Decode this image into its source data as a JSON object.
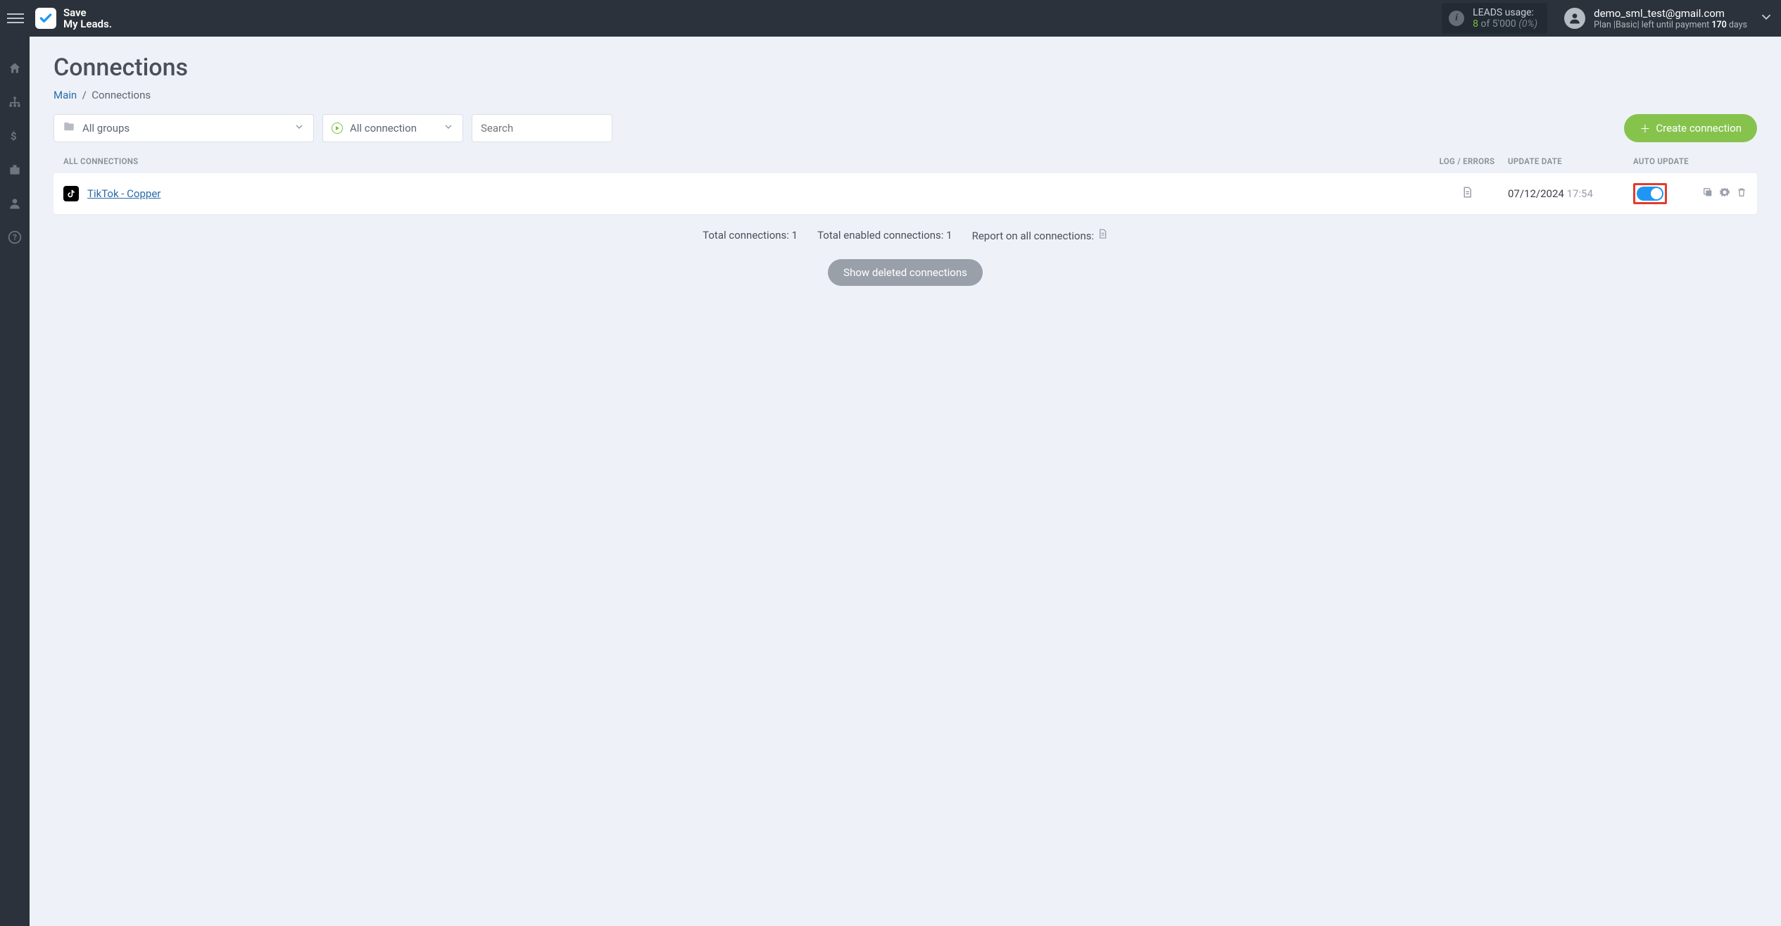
{
  "logo": {
    "line1": "Save",
    "line2": "My Leads."
  },
  "leads_usage": {
    "label": "LEADS usage:",
    "used": "8",
    "of": "of",
    "total": "5'000",
    "pct": "(0%)"
  },
  "account": {
    "email": "demo_sml_test@gmail.com",
    "plan_prefix": "Plan |Basic| left until payment ",
    "days": "170",
    "days_suffix": " days"
  },
  "page": {
    "title": "Connections"
  },
  "breadcrumb": {
    "main": "Main",
    "sep": "/",
    "current": "Connections"
  },
  "filters": {
    "groups": "All groups",
    "status": "All connection",
    "search_placeholder": "Search"
  },
  "create_btn": "Create connection",
  "headers": {
    "all": "ALL CONNECTIONS",
    "log": "LOG / ERRORS",
    "update": "UPDATE DATE",
    "auto": "AUTO UPDATE"
  },
  "rows": [
    {
      "name": "TikTok - Copper",
      "date": "07/12/2024",
      "time": "17:54"
    }
  ],
  "summary": {
    "total": "Total connections: 1",
    "enabled": "Total enabled connections: 1",
    "report": "Report on all connections:"
  },
  "show_deleted": "Show deleted connections"
}
